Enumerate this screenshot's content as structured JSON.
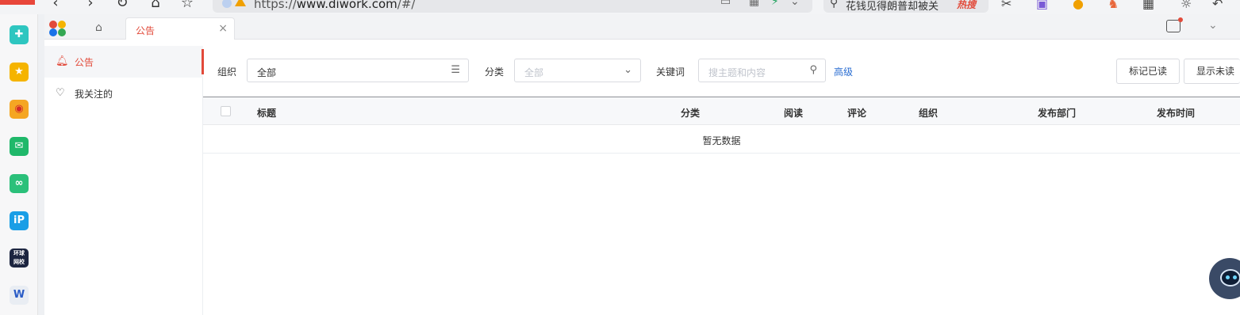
{
  "browser": {
    "badge": "",
    "url_prefix": "https://",
    "url_host": "www.diwork.com",
    "url_path": "/#/",
    "search_text": "花钱见得朗普却被关",
    "search_hot": "热搜"
  },
  "tabs": {
    "active_tab": "公告",
    "close_glyph": "×"
  },
  "sidebar": {
    "items": [
      {
        "label": "公告",
        "icon": "bell-icon",
        "active": true
      },
      {
        "label": "我关注的",
        "icon": "heart-icon",
        "active": false
      }
    ]
  },
  "filters": {
    "org_label": "组织",
    "org_value": "全部",
    "category_label": "分类",
    "category_placeholder": "全部",
    "keyword_label": "关键词",
    "keyword_placeholder": "搜主题和内容",
    "advanced_link": "高级",
    "mark_read_button": "标记已读",
    "show_unread_button": "显示未读"
  },
  "table": {
    "columns": [
      "标题",
      "分类",
      "阅读",
      "评论",
      "组织",
      "发布部门",
      "发布时间"
    ],
    "rows": [],
    "empty_text": "暂无数据"
  },
  "colors": {
    "accent": "#e24a3a",
    "link": "#2b6ed2"
  }
}
